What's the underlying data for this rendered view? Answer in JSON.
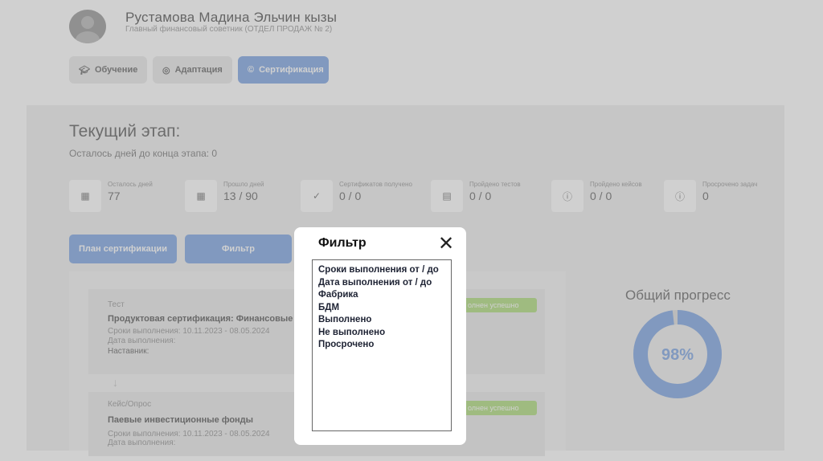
{
  "user": {
    "name": "Рустамова Мадина Эльчин кызы",
    "role": "Главный финансовый советник (ОТДЕЛ ПРОДАЖ № 2)"
  },
  "tabs": [
    {
      "label": "Обучение",
      "icon": "graduation-cap-icon"
    },
    {
      "label": "Адаптация",
      "icon": "user-circle-icon"
    },
    {
      "label": "Сертификация",
      "icon": "certificate-icon",
      "active": true
    }
  ],
  "stage": {
    "title": "Текущий этап:",
    "subtitle": "Осталось дней до конца этапа: 0"
  },
  "stats": [
    {
      "label": "Осталось дней",
      "value": "77",
      "icon": "calendar-icon"
    },
    {
      "label": "Прошло дней",
      "value": "13 / 90",
      "icon": "calendar-icon"
    },
    {
      "label": "Сертификатов получено",
      "value": "0 / 0",
      "icon": "check-circle-icon"
    },
    {
      "label": "Пройдено тестов",
      "value": "0 / 0",
      "icon": "document-icon"
    },
    {
      "label": "Пройдено кейсов",
      "value": "0 / 0",
      "icon": "alert-circle-icon"
    },
    {
      "label": "Просрочено задач",
      "value": "0",
      "icon": "alert-circle-icon"
    }
  ],
  "buttons": {
    "plan": "План сертификации",
    "filter": "Фильтр"
  },
  "cards": [
    {
      "type": "Тест",
      "title": "Продуктовая сертификация: Финансовые",
      "deadline": "Сроки выполнения: 10.11.2023 - 08.05.2024",
      "completed": "Дата выполнения:",
      "mentor": "Наставник:",
      "status": "олнен успешно"
    },
    {
      "type": "Кейс/Опрос",
      "title": "Паевые инвестиционные фонды",
      "deadline": "Сроки выполнения: 10.11.2023 - 08.05.2024",
      "completed": "Дата выполнения:",
      "status": "олнен успешно"
    }
  ],
  "progress": {
    "title": "Общий прогресс",
    "value_label": "98%",
    "fraction": 0.98,
    "color": "#6f9ce0"
  },
  "modal": {
    "title": "Фильтр",
    "close_icon": "close-icon",
    "items": [
      "Сроки выполнения от / до",
      "Дата выполнения от / до",
      "Фабрика",
      "БДМ",
      "Выполнено",
      "Не выполнено",
      "Просрочено"
    ]
  },
  "colors": {
    "accent": "#6f9ce0",
    "success": "#a7d96d"
  }
}
